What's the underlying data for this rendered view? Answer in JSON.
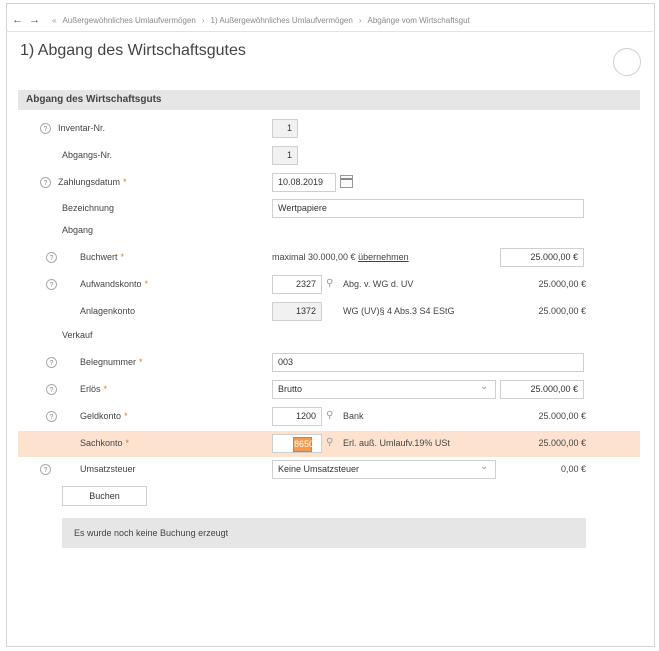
{
  "nav": {
    "back_icon": "arrow-left-icon",
    "forward_icon": "arrow-right-icon",
    "breadcrumb": [
      "Außergewöhnliches Umlaufvermögen",
      "1) Außergewöhnliches Umlaufvermögen",
      "Abgänge vom Wirtschaftsgut"
    ]
  },
  "page": {
    "title": "1) Abgang des Wirtschaftsgutes"
  },
  "section": {
    "title": "Abgang des Wirtschaftsguts"
  },
  "fields": {
    "inventar": {
      "label": "Inventar-Nr.",
      "value": "1"
    },
    "abgangs": {
      "label": "Abgangs-Nr.",
      "value": "1"
    },
    "zahlungsdatum": {
      "label": "Zahlungsdatum",
      "value": "10.08.2019"
    },
    "bezeichnung": {
      "label": "Bezeichnung",
      "value": "Wertpapiere"
    },
    "abgang": {
      "label": "Abgang"
    },
    "buchwert": {
      "label": "Buchwert",
      "hint": "maximal 30.000,00 €",
      "link": "übernehmen",
      "amount": "25.000,00 €"
    },
    "aufwandskonto": {
      "label": "Aufwandskonto",
      "account": "2327",
      "desc": "Abg. v. WG d. UV",
      "amount": "25.000,00 €"
    },
    "anlagenkonto": {
      "label": "Anlagenkonto",
      "account": "1372",
      "desc": "WG (UV)§ 4 Abs.3 S4 EStG",
      "amount": "25.000,00 €"
    },
    "verkauf": {
      "label": "Verkauf"
    },
    "belegnummer": {
      "label": "Belegnummer",
      "value": "003"
    },
    "erloes": {
      "label": "Erlös",
      "select": "Brutto",
      "amount": "25.000,00 €"
    },
    "geldkonto": {
      "label": "Geldkonto",
      "account": "1200",
      "desc": "Bank",
      "amount": "25.000,00 €"
    },
    "sachkonto": {
      "label": "Sachkonto",
      "account": "8650",
      "desc": "Erl. auß. Umlaufv.19% USt",
      "amount": "25.000,00 €"
    },
    "umsatzsteuer": {
      "label": "Umsatzsteuer",
      "select": "Keine Umsatzsteuer",
      "amount": "0,00 €"
    }
  },
  "buttons": {
    "buchen": "Buchen"
  },
  "info": {
    "message": "Es wurde noch keine Buchung erzeugt"
  },
  "colors": {
    "highlight": "#fde3cf",
    "required": "#e07a2e",
    "selection": "#f29a4e"
  }
}
